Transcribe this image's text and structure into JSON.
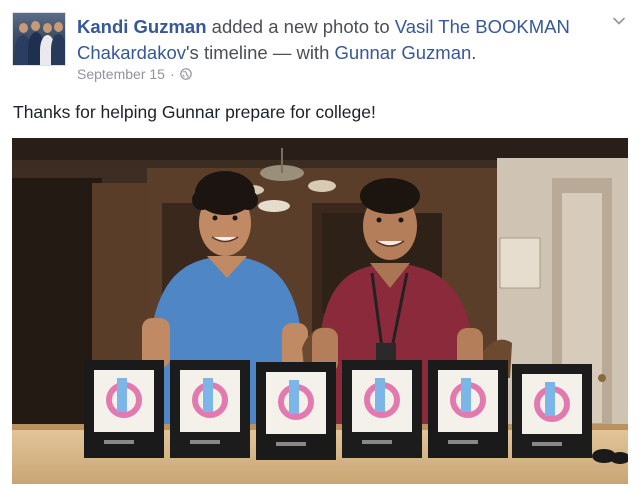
{
  "post": {
    "author": "Kandi Guzman",
    "action_text": " added a new photo to ",
    "target": "Vasil The BOOKMAN Chakardakov",
    "possessive": "'s timeline — with ",
    "tagged": "Gunnar Guzman",
    "period": ".",
    "date": "September 15",
    "separator": "·",
    "privacy_icon": "globe-icon",
    "menu_icon": "chevron-down-icon",
    "status": "Thanks for helping Gunnar prepare for college!"
  },
  "photo": {
    "alt_subject": "two smiling people behind a row of six black binders on a counter",
    "binder_count": 6,
    "colors": {
      "wall": "#4a3324",
      "counter": "#d8b98a",
      "binder": "#1a1a1a",
      "left_shirt": "#4f86c6",
      "right_shirt": "#8a2a3a"
    }
  }
}
